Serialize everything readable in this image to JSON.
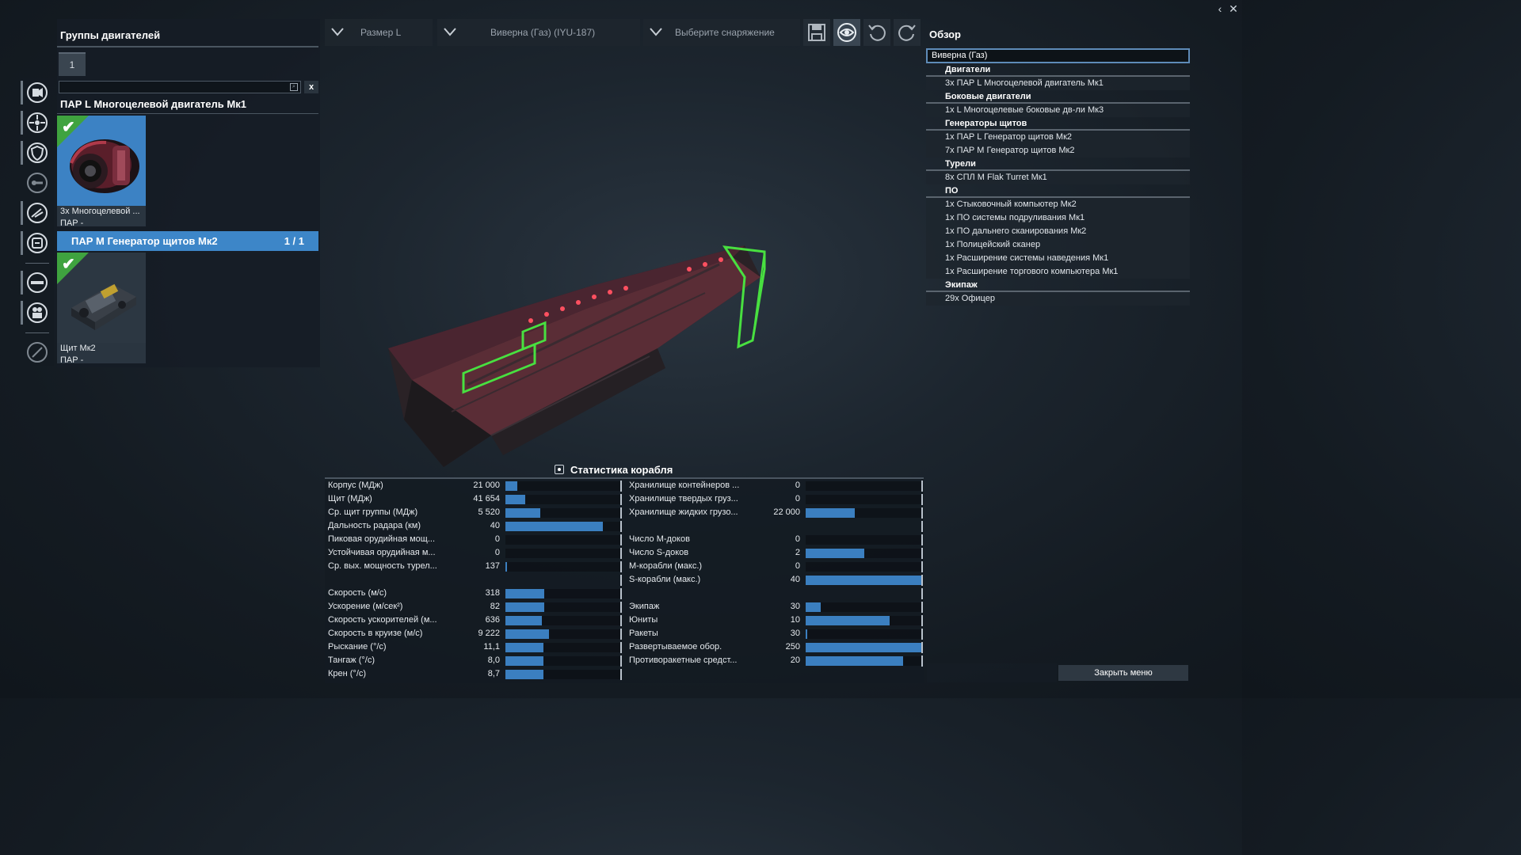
{
  "window_controls": {
    "back_icon": "chevron-left-icon",
    "close_icon": "close-icon"
  },
  "left_panel": {
    "title": "Группы двигателей",
    "tab_label": "1",
    "search_value": "",
    "clear_label": "x",
    "engine_group_title": "ПАР L Многоцелевой двигатель Мк1",
    "engine_card": {
      "caption": "3x Многоцелевой ...",
      "sub": "ПАР -"
    },
    "shield_group": {
      "title": "ПАР М Генератор щитов Мк2",
      "count": "1 / 1"
    },
    "shield_card": {
      "caption": "Щит Мк2",
      "sub": "ПАР -"
    }
  },
  "side_icons": [
    "engine-icon",
    "thruster-icon",
    "shield-icon",
    "turret-icon",
    "weapon-icon",
    "consumable-icon",
    "software-icon",
    "crew-icon",
    "paint-icon"
  ],
  "toolbar": {
    "size": "Размер L",
    "ship": "Виверна (Газ) (IYU-187)",
    "equipment": "Выберите снаряжение"
  },
  "overview": {
    "title": "Обзор",
    "ship_name": "Виверна (Газ)",
    "sections": [
      {
        "heading": "Двигатели",
        "items": [
          "3x ПАР L Многоцелевой двигатель Мк1"
        ]
      },
      {
        "heading": "Боковые двигатели",
        "items": [
          "1x L Многоцелевые боковые дв-ли Мк3"
        ]
      },
      {
        "heading": "Генераторы щитов",
        "items": [
          "1x ПАР L Генератор щитов Мк2",
          "7x ПАР М Генератор щитов Мк2"
        ]
      },
      {
        "heading": "Турели",
        "items": [
          "8x СПЛ М Flak Turret Мк1"
        ]
      },
      {
        "heading": "ПО",
        "items": [
          "1x Стыковочный компьютер Мк2",
          "1x ПО системы подруливания Мк1",
          "1x ПО дальнего сканирования Мк2",
          "1x Полицейский сканер",
          "1x Расширение системы наведения Мк1",
          "1x Расширение торгового компьютера Мк1"
        ]
      },
      {
        "heading": "Экипаж",
        "items": [
          "29x Офицер"
        ]
      }
    ]
  },
  "stats": {
    "title": "Статистика корабля",
    "left": [
      {
        "label": "Корпус (МДж)",
        "value": "21 000",
        "fill": 0.1
      },
      {
        "label": "Щит (МДж)",
        "value": "41 654",
        "fill": 0.17
      },
      {
        "label": "Ср. щит группы (МДж)",
        "value": "5 520",
        "fill": 0.3
      },
      {
        "label": "Дальность радара (км)",
        "value": "40",
        "fill": 0.85
      },
      {
        "label": "Пиковая орудийная мощ...",
        "value": "0",
        "fill": 0
      },
      {
        "label": "Устойчивая орудийная м...",
        "value": "0",
        "fill": 0
      },
      {
        "label": "Ср. вых. мощность турел...",
        "value": "137",
        "fill": 0.015
      },
      {
        "label": "",
        "value": "",
        "fill": 0
      },
      {
        "label": "Скорость (м/с)",
        "value": "318",
        "fill": 0.34
      },
      {
        "label": "Ускорение (м/сек²)",
        "value": "82",
        "fill": 0.34
      },
      {
        "label": "Скорость ускорителей (м...",
        "value": "636",
        "fill": 0.32
      },
      {
        "label": "Скорость в круизе (м/с)",
        "value": "9 222",
        "fill": 0.38
      },
      {
        "label": "Рыскание (°/с)",
        "value": "11,1",
        "fill": 0.33
      },
      {
        "label": "Тангаж (°/с)",
        "value": "8,0",
        "fill": 0.33
      },
      {
        "label": "Крен (°/с)",
        "value": "8,7",
        "fill": 0.33
      }
    ],
    "right": [
      {
        "label": "Хранилище контейнеров ...",
        "value": "0",
        "fill": 0
      },
      {
        "label": "Хранилище твердых груз...",
        "value": "0",
        "fill": 0
      },
      {
        "label": "Хранилище жидких грузо...",
        "value": "22 000",
        "fill": 0.42
      },
      {
        "label": "",
        "value": "",
        "fill": 0
      },
      {
        "label": "Число М-доков",
        "value": "0",
        "fill": 0
      },
      {
        "label": "Число S-доков",
        "value": "2",
        "fill": 0.5
      },
      {
        "label": "М-корабли (макс.)",
        "value": "0",
        "fill": 0
      },
      {
        "label": "S-корабли (макс.)",
        "value": "40",
        "fill": 1.0
      },
      {
        "label": "",
        "value": "",
        "fill": 0
      },
      {
        "label": "Экипаж",
        "value": "30",
        "fill": 0.13
      },
      {
        "label": "Юниты",
        "value": "10",
        "fill": 0.72
      },
      {
        "label": "Ракеты",
        "value": "30",
        "fill": 0.015
      },
      {
        "label": "Развертываемое обор.",
        "value": "250",
        "fill": 1.0
      },
      {
        "label": "Противоракетные средст...",
        "value": "20",
        "fill": 0.84
      }
    ]
  },
  "close_menu": "Закрыть меню",
  "colors": {
    "accent": "#3d86c8",
    "bar": "#3b7fc0",
    "check": "#3fa33f",
    "highlight": "#48e040"
  }
}
